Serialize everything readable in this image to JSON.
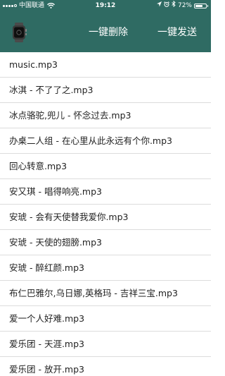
{
  "status_bar": {
    "carrier": "中国联通",
    "time": "19:12",
    "battery_percent": "72%",
    "battery_level": 0.72,
    "icons": [
      "signal-icon",
      "wifi-icon",
      "location-icon",
      "alarm-icon",
      "bluetooth-icon",
      "battery-icon"
    ]
  },
  "header": {
    "icon": "watch-icon",
    "delete_all_label": "一键删除",
    "send_all_label": "一键发送"
  },
  "files": [
    "music.mp3",
    "冰淇 - 不了了之.mp3",
    "冰点骆驼,兜儿 - 怀念过去.mp3",
    "办桌二人组 - 在心里从此永远有个你.mp3",
    "回心转意.mp3",
    "安又琪 - 唱得响亮.mp3",
    "安琥 - 会有天使替我爱你.mp3",
    "安琥 - 天使的翅膀.mp3",
    "安琥 - 醉红颜.mp3",
    "布仁巴雅尔,乌日娜,英格玛 - 吉祥三宝.mp3",
    "爱一个人好难.mp3",
    "爱乐团 - 天涯.mp3",
    "爱乐团 - 放开.mp3"
  ],
  "colors": {
    "header_bg": "#2f6b63",
    "divider": "#dcdcdc",
    "text": "#222222"
  }
}
